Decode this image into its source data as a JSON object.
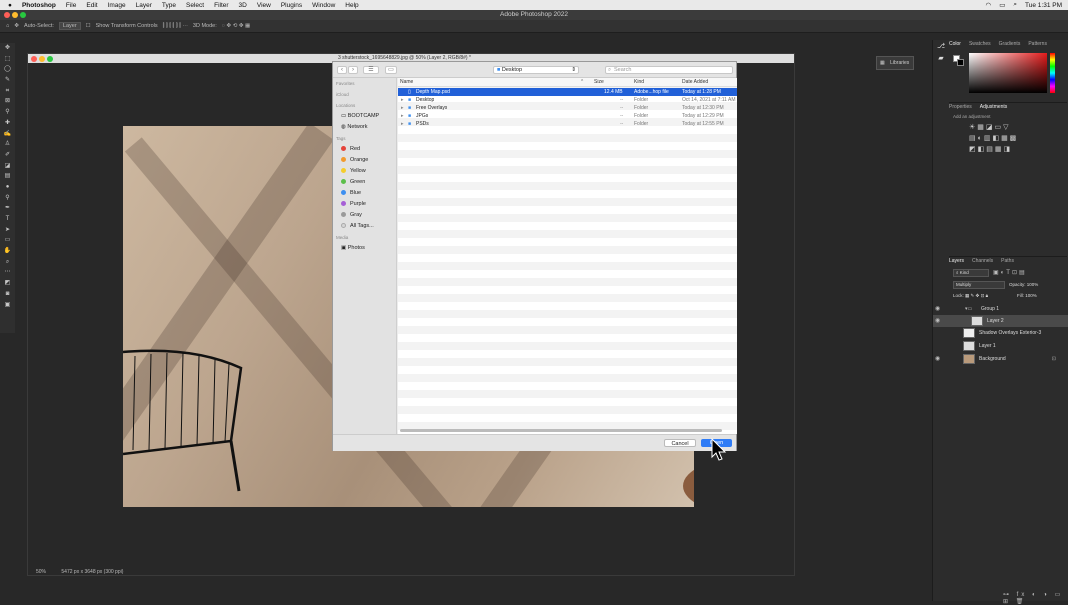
{
  "menubar": {
    "app": "Photoshop",
    "items": [
      "File",
      "Edit",
      "Image",
      "Layer",
      "Type",
      "Select",
      "Filter",
      "3D",
      "View",
      "Plugins",
      "Window",
      "Help"
    ],
    "clock": "Tue 1:31 PM"
  },
  "window_title": "Adobe Photoshop 2022",
  "options": {
    "auto_select": "Auto-Select:",
    "target": "Layer",
    "transform": "Show Transform Controls",
    "mode3d": "3D Mode:"
  },
  "document": {
    "tab_title": "3 shutterstock_1695648829.jpg @ 50% (Layer 2, RGB/8#) *",
    "zoom": "50%",
    "doc_size": "5472 px x 3648 px (300 ppi)"
  },
  "dialog": {
    "location": "Desktop",
    "search_placeholder": "Search",
    "columns": {
      "name": "Name",
      "size": "Size",
      "kind": "Kind",
      "date": "Date Added"
    },
    "files": [
      {
        "name": "Depth Map.psd",
        "size": "12.4 MB",
        "kind": "Adobe...hop file",
        "date": "Today at 1:28 PM",
        "selected": true
      },
      {
        "name": "Desktop",
        "size": "--",
        "kind": "Folder",
        "date": "Oct 14, 2021 at 7:11 AM"
      },
      {
        "name": "Free Overlays",
        "size": "--",
        "kind": "Folder",
        "date": "Today at 12:30 PM"
      },
      {
        "name": "JPGs",
        "size": "--",
        "kind": "Folder",
        "date": "Today at 12:29 PM"
      },
      {
        "name": "PSDs",
        "size": "--",
        "kind": "Folder",
        "date": "Today at 12:55 PM"
      }
    ],
    "sidebar": {
      "favorites": "Favorites",
      "icloud": "iCloud",
      "locations": "Locations",
      "location_items": [
        "BOOTCAMP",
        "Network"
      ],
      "tags": "Tags",
      "tag_items": [
        {
          "label": "Red",
          "color": "#e5433a"
        },
        {
          "label": "Orange",
          "color": "#f29a2e"
        },
        {
          "label": "Yellow",
          "color": "#f5cd2b"
        },
        {
          "label": "Green",
          "color": "#5cbf4a"
        },
        {
          "label": "Blue",
          "color": "#3d8ff0"
        },
        {
          "label": "Purple",
          "color": "#a65fd6"
        },
        {
          "label": "Gray",
          "color": "#9a9a9a"
        },
        {
          "label": "All Tags...",
          "color": "#d6d6d6"
        }
      ],
      "media": "Media",
      "media_items": [
        "Photos"
      ]
    },
    "cancel": "Cancel",
    "open": "Open"
  },
  "libraries": "Libraries",
  "color_panel": {
    "tabs": [
      "Color",
      "Swatches",
      "Gradients",
      "Patterns"
    ]
  },
  "adjust_panel": {
    "tabs": [
      "Properties",
      "Adjustments"
    ],
    "hint": "Add an adjustment"
  },
  "layers_panel": {
    "tabs": [
      "Layers",
      "Channels",
      "Paths"
    ],
    "kind": "Kind",
    "blend": "Multiply",
    "opacity_label": "Opacity:",
    "opacity": "100%",
    "lock_label": "Lock:",
    "fill_label": "Fill:",
    "fill": "100%",
    "layers": [
      "Group 1",
      "Layer 2",
      "Shadow Overlays Exterior-3",
      "Layer 1",
      "Background"
    ]
  }
}
